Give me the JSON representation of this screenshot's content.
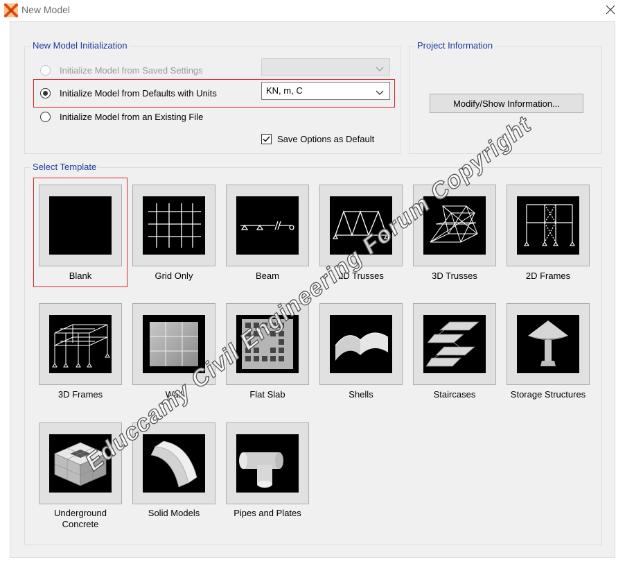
{
  "window": {
    "title": "New Model",
    "app_icon": "sap-x-icon",
    "close_icon": "close-icon"
  },
  "initialization": {
    "group_title": "New Model Initialization",
    "options": [
      {
        "label": "Initialize Model from Saved Settings",
        "selected": false,
        "enabled": false
      },
      {
        "label": "Initialize Model from Defaults with Units",
        "selected": true,
        "enabled": true
      },
      {
        "label": "Initialize Model from an Existing File",
        "selected": false,
        "enabled": true
      }
    ],
    "saved_settings_combo": "",
    "units_combo": "KN, m, C",
    "save_default_label": "Save Options as Default",
    "save_default_checked": true
  },
  "project": {
    "group_title": "Project Information",
    "button_label": "Modify/Show Information..."
  },
  "templates": {
    "group_title": "Select Template",
    "selected": "Blank",
    "items": [
      {
        "label": "Blank",
        "icon": "blank-template-icon"
      },
      {
        "label": "Grid Only",
        "icon": "grid-only-template-icon"
      },
      {
        "label": "Beam",
        "icon": "beam-template-icon"
      },
      {
        "label": "2D Trusses",
        "icon": "2d-trusses-template-icon"
      },
      {
        "label": "3D Trusses",
        "icon": "3d-trusses-template-icon"
      },
      {
        "label": "2D Frames",
        "icon": "2d-frames-template-icon"
      },
      {
        "label": "3D Frames",
        "icon": "3d-frames-template-icon"
      },
      {
        "label": "Wall",
        "icon": "wall-template-icon"
      },
      {
        "label": "Flat Slab",
        "icon": "flat-slab-template-icon"
      },
      {
        "label": "Shells",
        "icon": "shells-template-icon"
      },
      {
        "label": "Staircases",
        "icon": "staircases-template-icon"
      },
      {
        "label": "Storage Structures",
        "icon": "storage-structures-template-icon"
      },
      {
        "label": "Underground Concrete",
        "icon": "underground-concrete-template-icon"
      },
      {
        "label": "Solid Models",
        "icon": "solid-models-template-icon"
      },
      {
        "label": "Pipes and Plates",
        "icon": "pipes-and-plates-template-icon"
      }
    ]
  },
  "watermark": {
    "text": "Educcamy Civil Engineering Forum Copyright"
  },
  "colors": {
    "group_title": "#1a3a9c",
    "highlight": "#e0202a",
    "dialog_bg": "#f0f0f0"
  }
}
